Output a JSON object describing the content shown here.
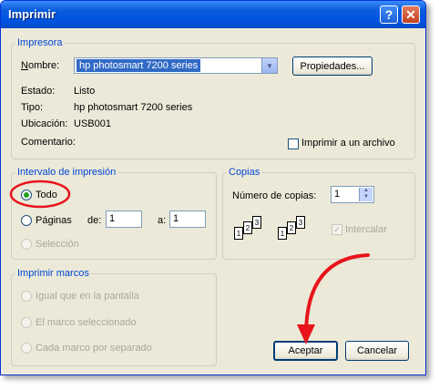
{
  "window": {
    "title": "Imprimir",
    "help_glyph": "?",
    "close_glyph": "✕"
  },
  "printer": {
    "group": "Impresora",
    "name_label": "Nombre:",
    "name_value": "hp photosmart 7200 series",
    "properties_button": "Propiedades...",
    "status_label": "Estado:",
    "status_value": "Listo",
    "type_label": "Tipo:",
    "type_value": "hp photosmart 7200 series",
    "location_label": "Ubicación:",
    "location_value": "USB001",
    "comment_label": "Comentario:",
    "print_to_file_label": "Imprimir a un archivo"
  },
  "range": {
    "group": "Intervalo de impresión",
    "all": "Todo",
    "pages": "Páginas",
    "from_label": "de:",
    "from_value": "1",
    "to_label": "a:",
    "to_value": "1",
    "selection": "Selección"
  },
  "copies": {
    "group": "Copias",
    "count_label": "Número de copias:",
    "count_value": "1",
    "collate": "Intercalar",
    "page_numbers": [
      "1",
      "2",
      "3"
    ]
  },
  "frames": {
    "group": "Imprimir marcos",
    "option_1": "Igual que en la pantalla",
    "option_2": "El marco seleccionado",
    "option_3": "Cada marco por separado"
  },
  "buttons": {
    "ok": "Aceptar",
    "cancel": "Cancelar"
  },
  "annotation_color": "#e8141c"
}
